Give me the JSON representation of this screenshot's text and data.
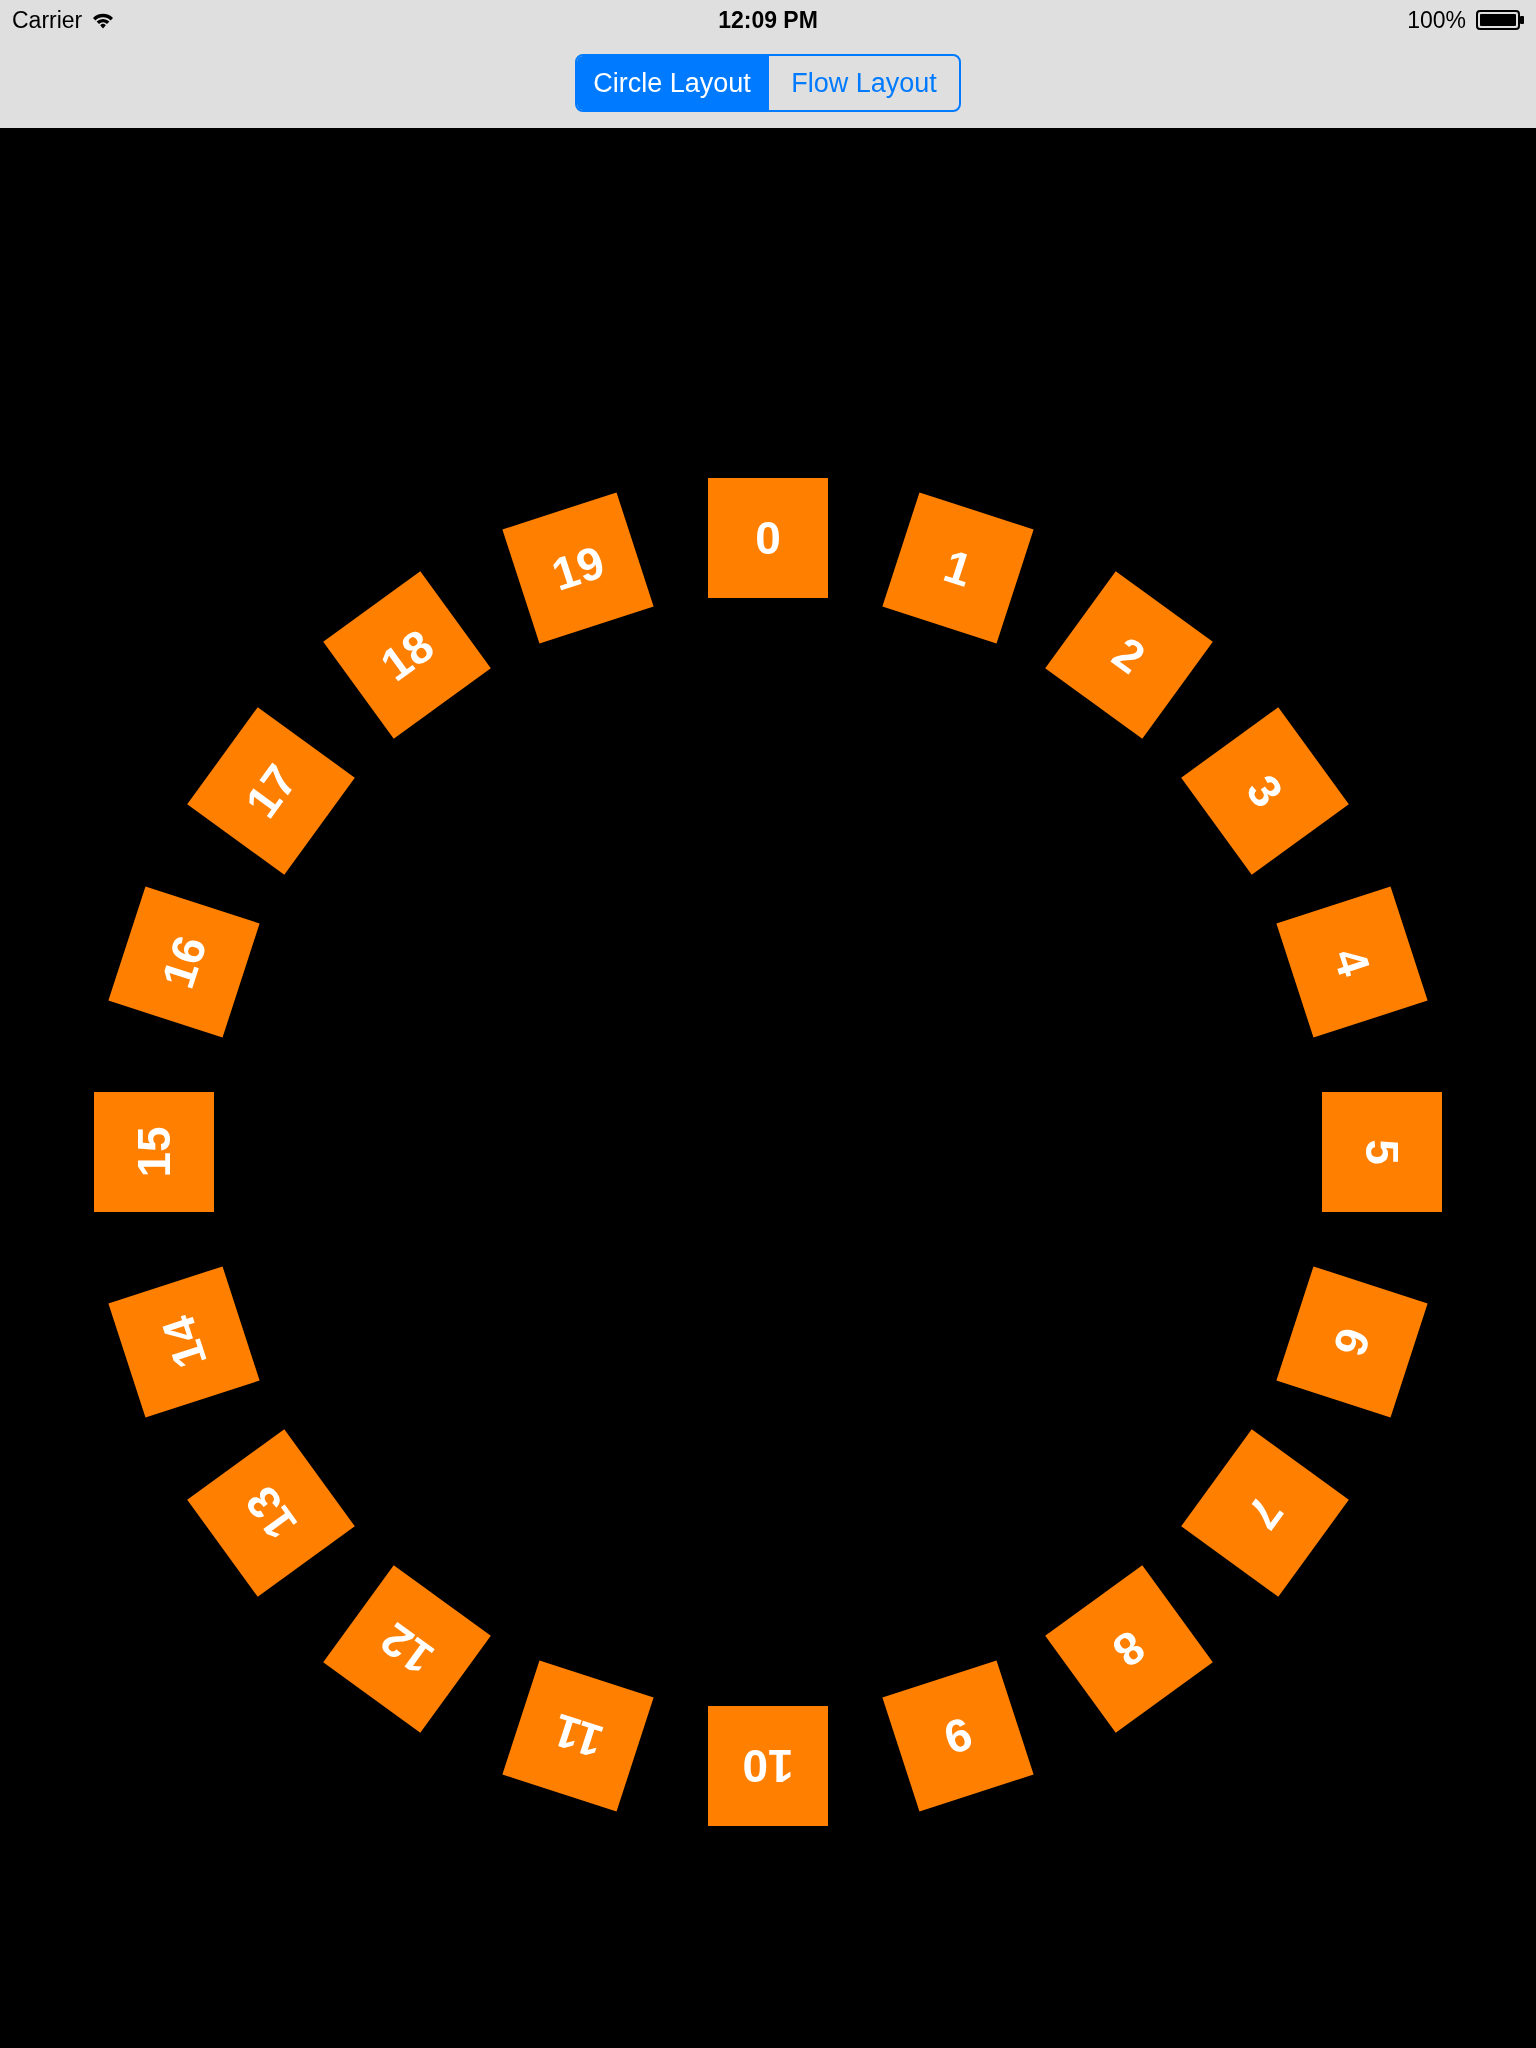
{
  "status_bar": {
    "carrier": "Carrier",
    "time": "12:09 PM",
    "battery": "100%"
  },
  "segmented_control": [
    {
      "label": "Circle Layout",
      "selected": true
    },
    {
      "label": "Flow Layout",
      "selected": false
    }
  ],
  "tiles": [
    {
      "label": "0"
    },
    {
      "label": "1"
    },
    {
      "label": "2"
    },
    {
      "label": "3"
    },
    {
      "label": "4"
    },
    {
      "label": "5"
    },
    {
      "label": "6"
    },
    {
      "label": "7"
    },
    {
      "label": "8"
    },
    {
      "label": "9"
    },
    {
      "label": "10"
    },
    {
      "label": "11"
    },
    {
      "label": "12"
    },
    {
      "label": "13"
    },
    {
      "label": "14"
    },
    {
      "label": "15"
    },
    {
      "label": "16"
    },
    {
      "label": "17"
    },
    {
      "label": "18"
    },
    {
      "label": "19"
    }
  ]
}
